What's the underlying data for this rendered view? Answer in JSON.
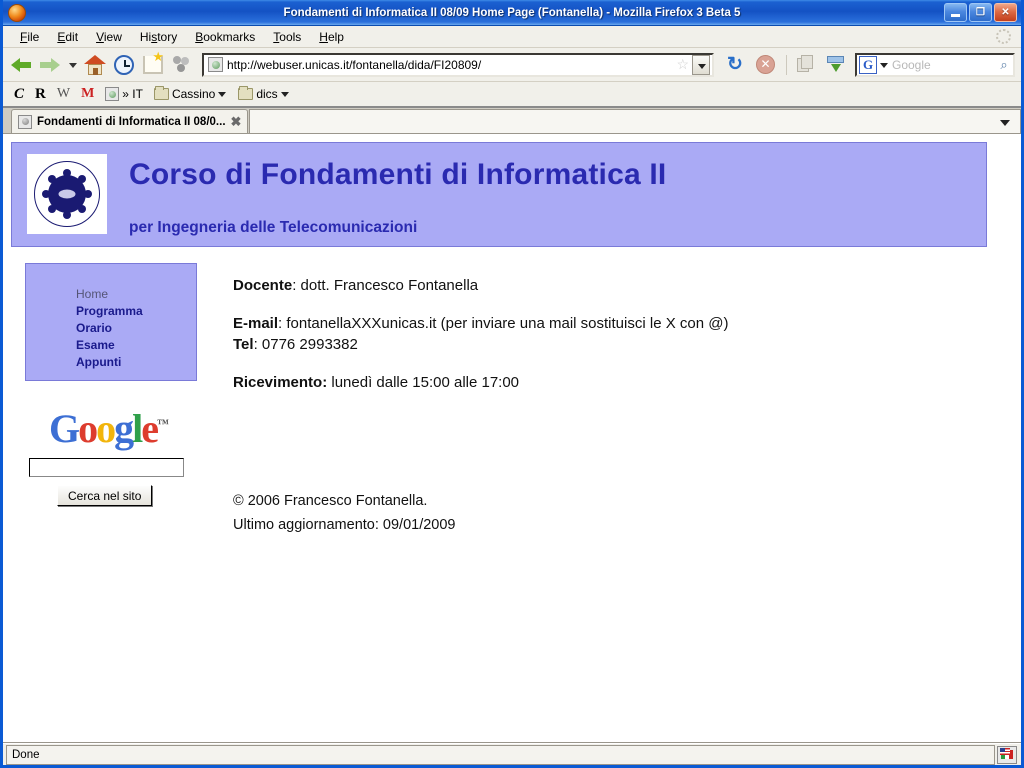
{
  "window": {
    "title": "Fondamenti di Informatica II 08/09 Home Page (Fontanella) - Mozilla Firefox 3 Beta 5",
    "minimize_label": "",
    "restore_label": "❐",
    "close_label": "✕"
  },
  "menu": [
    {
      "pre": "",
      "accel": "F",
      "post": "ile"
    },
    {
      "pre": "",
      "accel": "E",
      "post": "dit"
    },
    {
      "pre": "",
      "accel": "V",
      "post": "iew"
    },
    {
      "pre": "Hi",
      "accel": "s",
      "post": "tory"
    },
    {
      "pre": "",
      "accel": "B",
      "post": "ookmarks"
    },
    {
      "pre": "",
      "accel": "T",
      "post": "ools"
    },
    {
      "pre": "",
      "accel": "H",
      "post": "elp"
    }
  ],
  "toolbar": {
    "url": "http://webuser.unicas.it/fontanella/dida/FI20809/",
    "star_glyph": "☆",
    "reload_glyph": "↻",
    "stop_glyph": "✕",
    "search_placeholder": "Google",
    "search_engine_letter": "G",
    "magnifier_glyph": "⌕"
  },
  "bookmarks": [
    {
      "type": "letter-c",
      "label": "C"
    },
    {
      "type": "letter-r",
      "label": "R"
    },
    {
      "type": "letter-w",
      "label": "W"
    },
    {
      "type": "letter-m",
      "label": "M"
    },
    {
      "type": "favicon-it",
      "label": "» IT"
    },
    {
      "type": "folder",
      "label": "Cassino"
    },
    {
      "type": "folder",
      "label": "dics"
    }
  ],
  "tab": {
    "title": "Fondamenti di Informatica II 08/0...",
    "close_glyph": "✖"
  },
  "page": {
    "header": {
      "title": "Corso di Fondamenti di Informatica II",
      "subtitle": "per Ingegneria delle Telecomunicazioni",
      "crest_alt": "Universitas Casinas Studiorum"
    },
    "nav": [
      {
        "label": "Home",
        "current": true
      },
      {
        "label": "Programma",
        "current": false
      },
      {
        "label": "Orario",
        "current": false
      },
      {
        "label": "Esame",
        "current": false
      },
      {
        "label": "Appunti",
        "current": false
      }
    ],
    "gsearch": {
      "logo_letters": [
        "G",
        "o",
        "o",
        "g",
        "l",
        "e"
      ],
      "trademark": "™",
      "input_value": "",
      "button_label": "Cerca nel sito"
    },
    "content": {
      "docente_label": "Docente",
      "docente_value": ": dott. Francesco Fontanella",
      "email_label": "E-mail",
      "email_value": ": fontanellaXXXunicas.it (per inviare una mail sostituisci le X con @)",
      "tel_label": "Tel",
      "tel_value": ": 0776 2993382",
      "ricevimento_label": "Ricevimento:",
      "ricevimento_value": " lunedì dalle 15:00 alle 17:00"
    },
    "footer": {
      "copyright": "© 2006 Francesco Fontanella.",
      "updated": "Ultimo aggiornamento: 09/01/2009"
    }
  },
  "status": {
    "text": "Done"
  },
  "colors": {
    "header_bg": "#aaaaf5",
    "header_text": "#2a2ab0",
    "link": "#1a1a8c",
    "titlebar": "#1452c4"
  }
}
